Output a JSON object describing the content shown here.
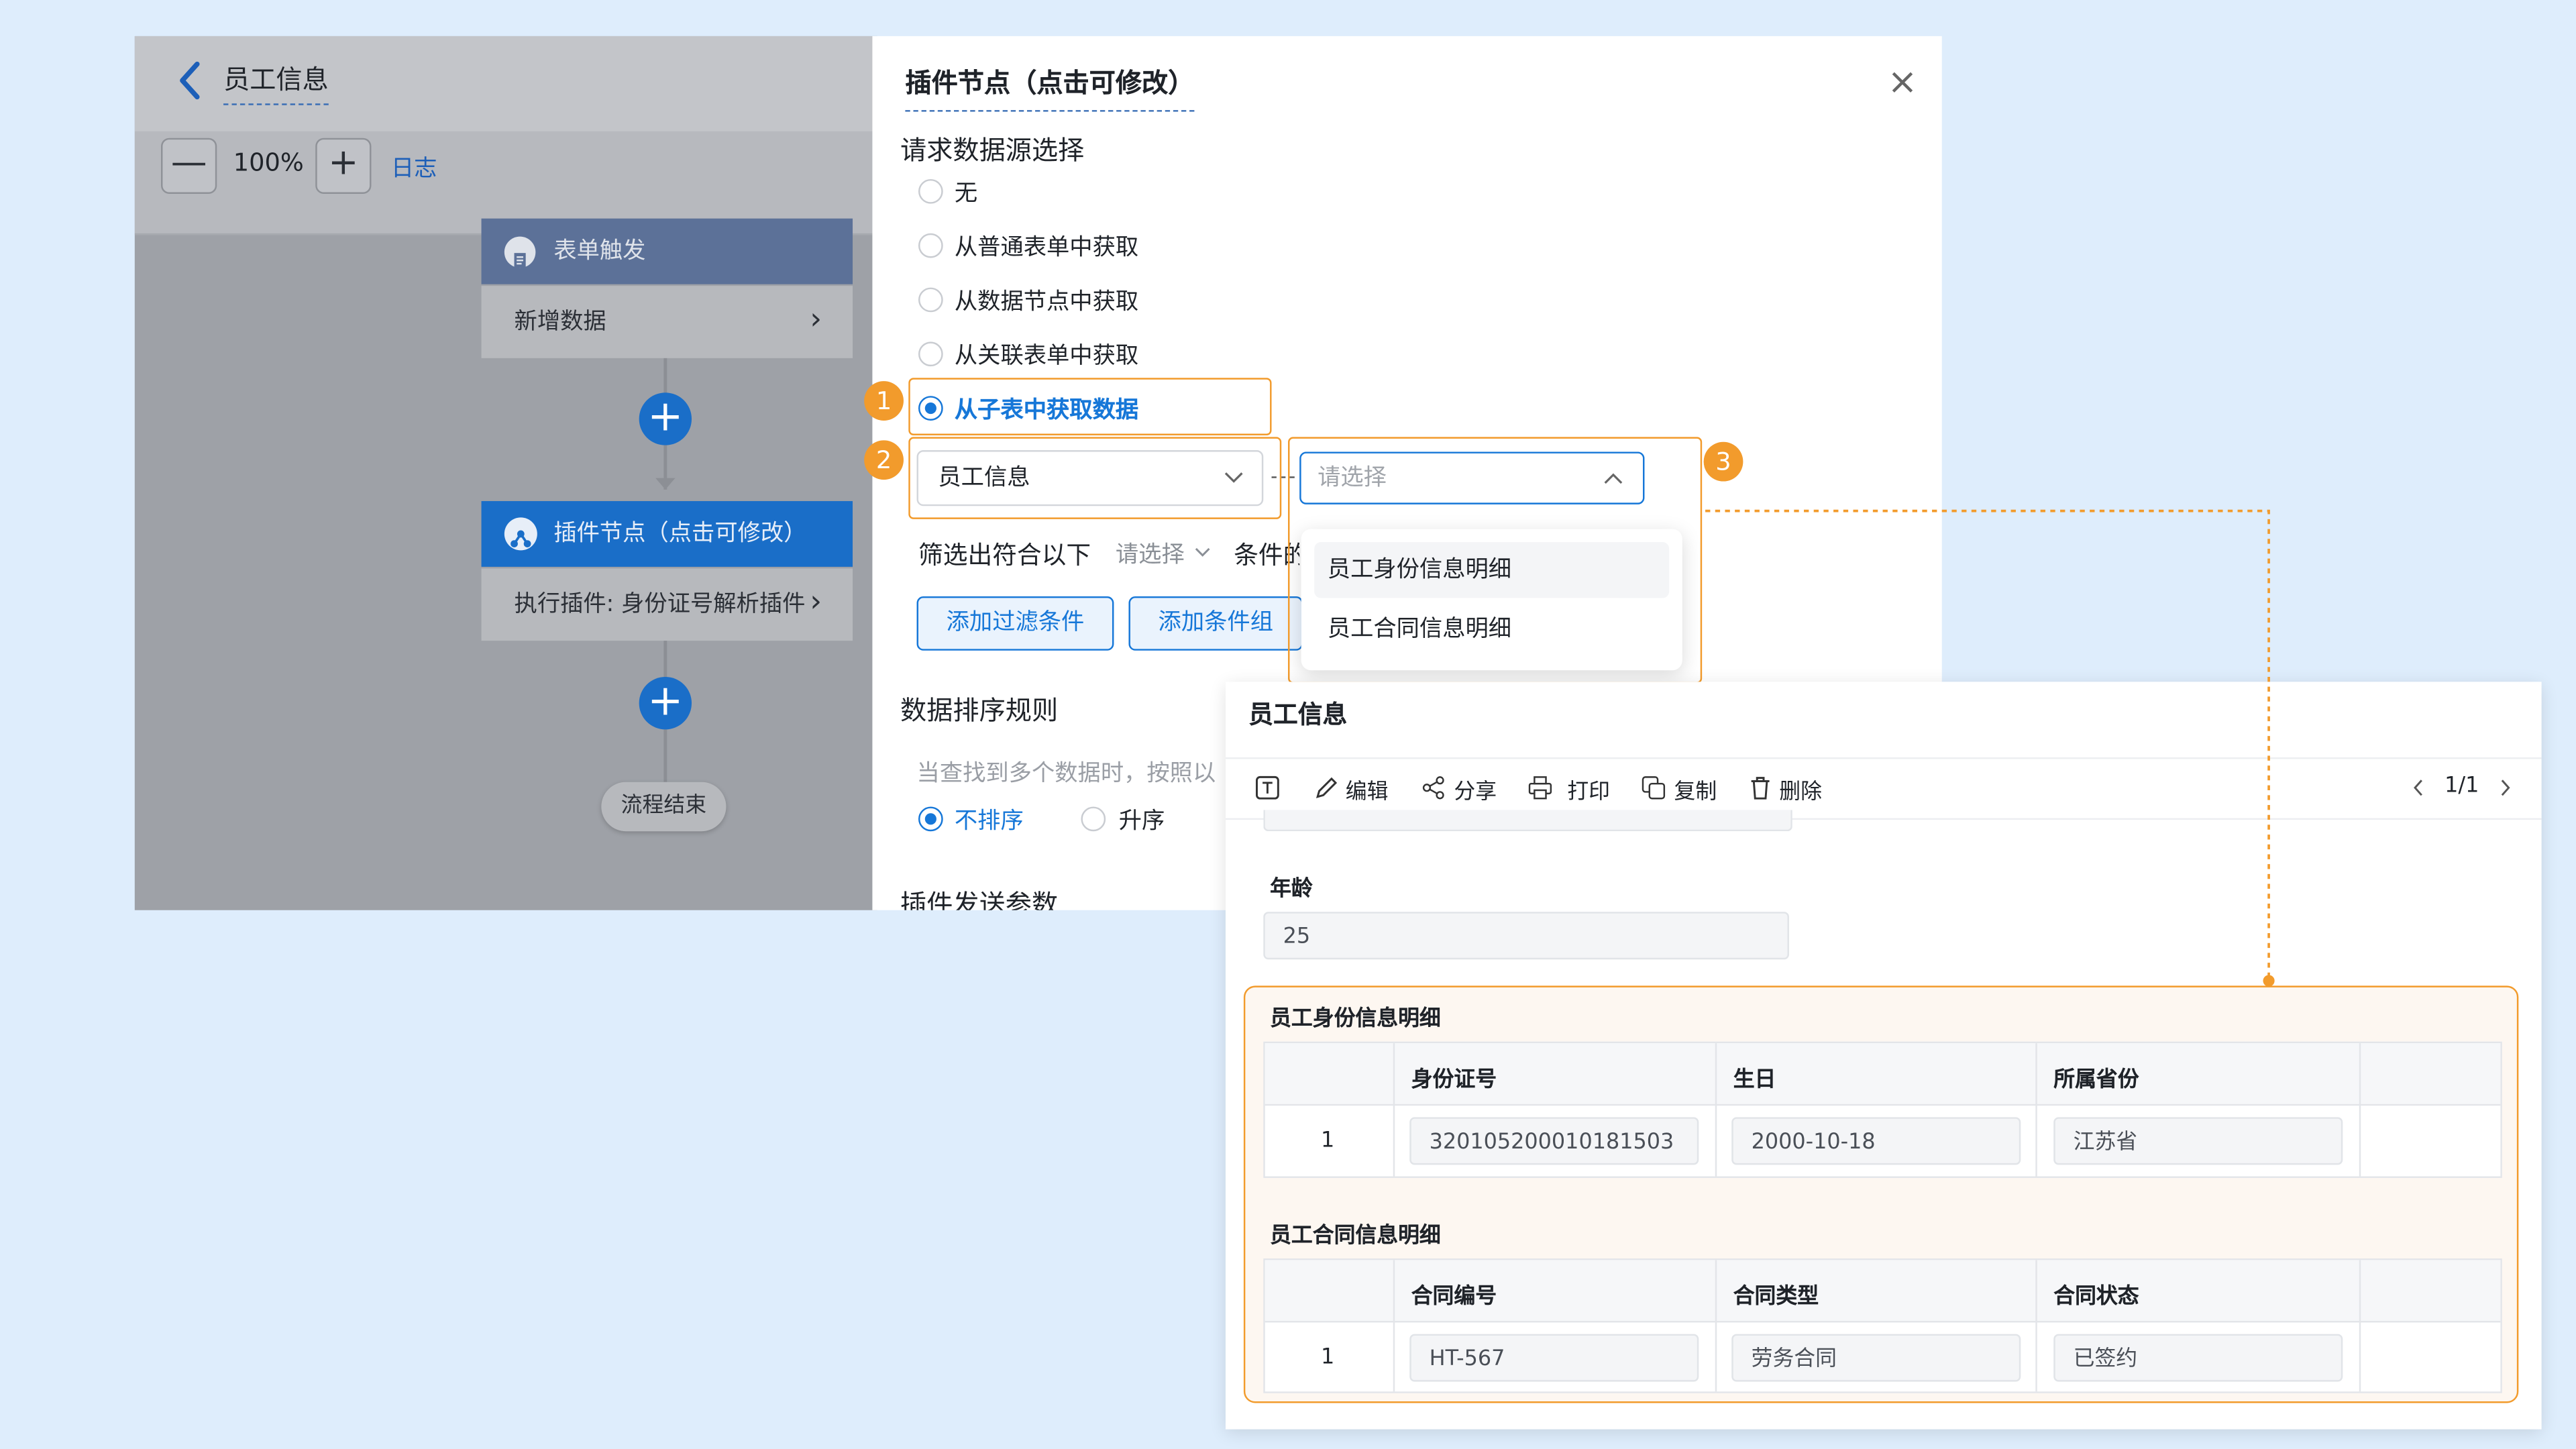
{
  "page": {
    "back_label": "返回",
    "title": "员工信息"
  },
  "toolbar": {
    "minus": "—",
    "zoom": "100%",
    "plus": "+",
    "log": "日志"
  },
  "flow": {
    "trigger_title": "表单触发",
    "trigger_detail": "新增数据",
    "plugin_title": "插件节点（点击可修改）",
    "plugin_detail": "执行插件: 身份证号解析插件",
    "end": "流程结束",
    "chevron": "›",
    "add": "+"
  },
  "drawer": {
    "title": "插件节点（点击可修改）",
    "close": "×",
    "source_label": "请求数据源选择",
    "options": [
      "无",
      "从普通表单中获取",
      "从数据节点中获取",
      "从关联表单中获取",
      "从子表中获取数据"
    ],
    "selected_option": "从子表中获取数据",
    "form_select": "员工信息",
    "subtable_placeholder": "请选择",
    "filter_prefix": "筛选出符合以下",
    "filter_select": "请选择",
    "filter_suffix": "条件的",
    "add_filter": "添加过滤条件",
    "add_group": "添加条件组",
    "sort_label": "数据排序规则",
    "sort_hint": "当查找到多个数据时，按照以",
    "sort_options": [
      "不排序",
      "升序"
    ],
    "send_label": "插件发送参数",
    "dropdown_items": [
      "员工身份信息明细",
      "员工合同信息明细"
    ],
    "badges": [
      "1",
      "2",
      "3"
    ]
  },
  "record": {
    "title": "员工信息",
    "tools": [
      "编辑",
      "分享",
      "打印",
      "复制",
      "删除"
    ],
    "pager": "1/1",
    "age_label": "年龄",
    "age_value": "25",
    "identity": {
      "title": "员工身份信息明细",
      "columns": [
        "身份证号",
        "生日",
        "所属省份"
      ],
      "row": {
        "index": "1",
        "cells": [
          "320105200010181503",
          "2000-10-18",
          "江苏省"
        ]
      }
    },
    "contract": {
      "title": "员工合同信息明细",
      "columns": [
        "合同编号",
        "合同类型",
        "合同状态"
      ],
      "row": {
        "index": "1",
        "cells": [
          "HT-567",
          "劳务合同",
          "已签约"
        ]
      }
    }
  },
  "colors": {
    "accent": "#1677d8",
    "highlight": "#f29b2c",
    "node_blue": "#1a6ec8",
    "background": "#deedfc"
  }
}
